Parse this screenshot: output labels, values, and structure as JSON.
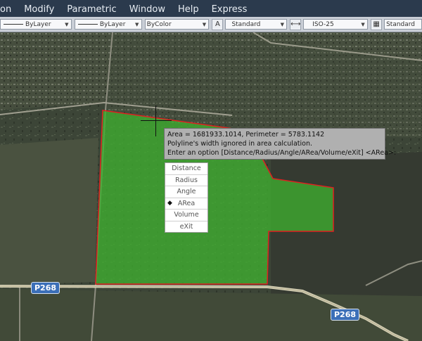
{
  "menubar": {
    "items": [
      "on",
      "Modify",
      "Parametric",
      "Window",
      "Help",
      "Express"
    ]
  },
  "toolbar": {
    "layer_color": "ByLayer",
    "layer_linetype": "ByLayer",
    "plot_style": "ByColor",
    "text_style": "Standard",
    "dim_style": "ISO-25",
    "table_style": "Standard",
    "text_style_icon": "text-style-icon",
    "dim_style_icon": "dim-style-icon",
    "table_style_icon": "table-style-icon"
  },
  "command_tooltip": {
    "line1": "Area = 1681933.1014, Perimeter = 5783.1142",
    "line2": "Polyline's width ignored in area calculation.",
    "line3": "Enter an option [Distance/Radius/Angle/ARea/Volume/eXit] <ARea>:"
  },
  "options": [
    {
      "label": "Distance",
      "selected": false
    },
    {
      "label": "Radius",
      "selected": false
    },
    {
      "label": "Angle",
      "selected": false
    },
    {
      "label": "ARea",
      "selected": true
    },
    {
      "label": "Volume",
      "selected": false
    },
    {
      "label": "eXit",
      "selected": false
    }
  ],
  "map": {
    "road_label_1": "P268",
    "road_label_2": "P268",
    "area_fill_color": "#3fae2f",
    "area_outline_color": "#e02020"
  }
}
